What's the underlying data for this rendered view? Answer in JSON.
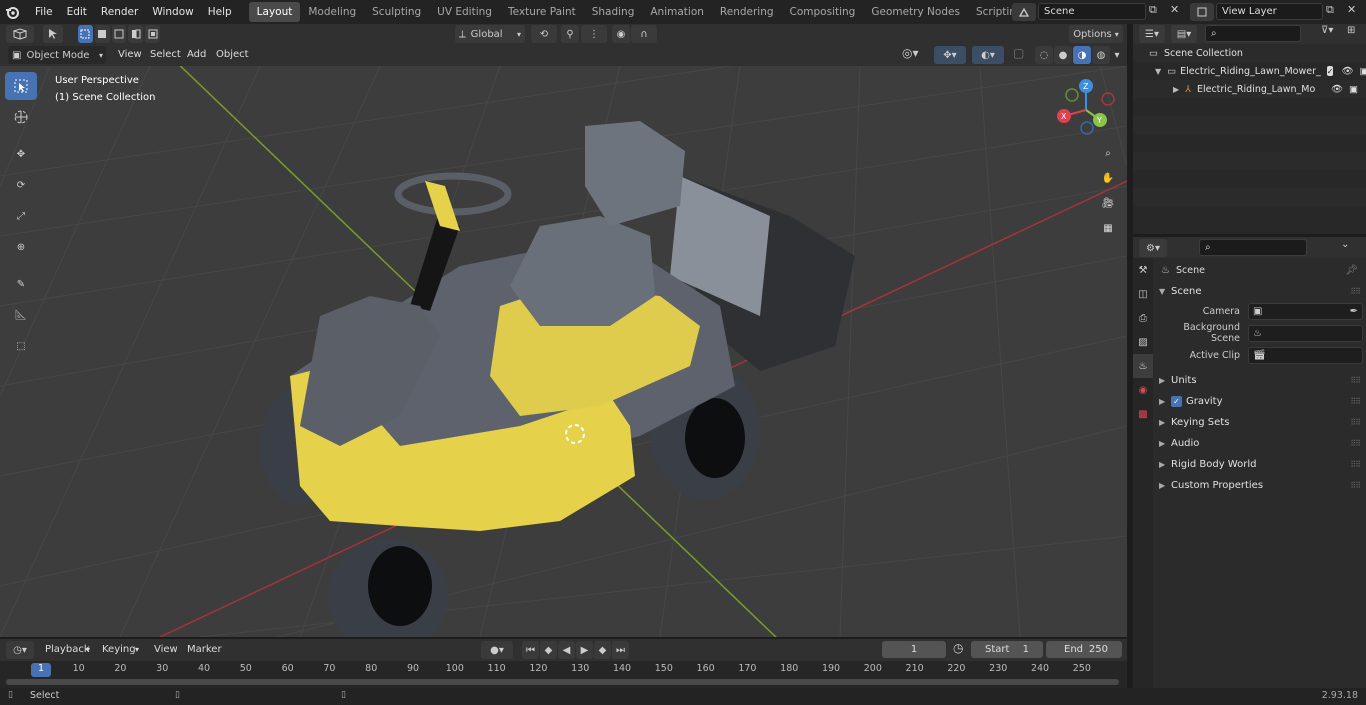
{
  "menu": {
    "items": [
      "File",
      "Edit",
      "Render",
      "Window",
      "Help"
    ]
  },
  "workspaces": {
    "tabs": [
      "Layout",
      "Modeling",
      "Sculpting",
      "UV Editing",
      "Texture Paint",
      "Shading",
      "Animation",
      "Rendering",
      "Compositing",
      "Geometry Nodes",
      "Scripting"
    ],
    "active": "Layout",
    "add": "+"
  },
  "scene_selector": {
    "value": "Scene"
  },
  "view_layer": {
    "value": "View Layer"
  },
  "viewport": {
    "mode": "Object Mode",
    "menus": [
      "View",
      "Select",
      "Add",
      "Object"
    ],
    "transform_orientation": "Global",
    "options": "Options",
    "overlay_title": "User Perspective",
    "overlay_subtitle": "(1) Scene Collection",
    "gizmo": {
      "z": "Z",
      "y": "Y",
      "x": "X"
    }
  },
  "outliner": {
    "root": "Scene Collection",
    "collection": "Electric_Riding_Lawn_Mower_",
    "object": "Electric_Riding_Lawn_Mo"
  },
  "properties": {
    "context": "Scene",
    "section": "Scene",
    "fields": [
      {
        "label": "Camera",
        "value": ""
      },
      {
        "label": "Background Scene",
        "value": ""
      },
      {
        "label": "Active Clip",
        "value": ""
      }
    ],
    "panels": [
      "Units",
      "Gravity",
      "Keying Sets",
      "Audio",
      "Rigid Body World",
      "Custom Properties"
    ],
    "gravity_checked": true
  },
  "timeline": {
    "menus": [
      "Playback",
      "Keying",
      "View",
      "Marker"
    ],
    "current_frame": "1",
    "start_label": "Start",
    "start": "1",
    "end_label": "End",
    "end": "250",
    "ticks": [
      "1",
      "10",
      "20",
      "30",
      "40",
      "50",
      "60",
      "70",
      "80",
      "90",
      "100",
      "110",
      "120",
      "130",
      "140",
      "150",
      "160",
      "170",
      "180",
      "190",
      "200",
      "210",
      "220",
      "230",
      "240",
      "250"
    ]
  },
  "status": {
    "left": "Select",
    "version": "2.93.18"
  },
  "colors": {
    "accent": "#4772b3",
    "x_axis": "#e0404f",
    "y_axis": "#8bc34a",
    "z_axis": "#3d8fe0",
    "mower_yellow": "#e6d24a"
  }
}
